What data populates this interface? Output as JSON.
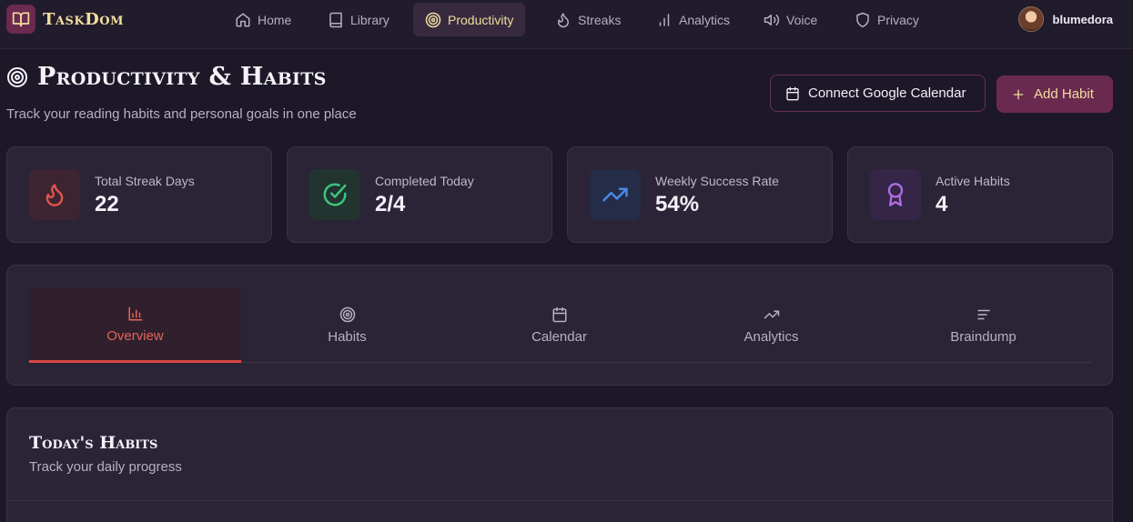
{
  "app": {
    "name": "TaskDom"
  },
  "nav": {
    "items": [
      {
        "label": "Home",
        "icon": "home-icon"
      },
      {
        "label": "Library",
        "icon": "book-icon"
      },
      {
        "label": "Productivity",
        "icon": "target-icon",
        "active": true
      },
      {
        "label": "Streaks",
        "icon": "flame-icon"
      },
      {
        "label": "Analytics",
        "icon": "bar-chart-icon"
      },
      {
        "label": "Voice",
        "icon": "speaker-icon"
      },
      {
        "label": "Privacy",
        "icon": "shield-icon"
      }
    ],
    "user": {
      "name": "blumedora"
    }
  },
  "header": {
    "title": "Productivity & Habits",
    "subtitle": "Track your reading habits and personal goals in one place",
    "connect_calendar_label": "Connect Google Calendar",
    "add_habit_label": "Add Habit"
  },
  "stats": [
    {
      "label": "Total Streak Days",
      "value": "22",
      "icon": "flame-icon",
      "color": "#e0564f"
    },
    {
      "label": "Completed Today",
      "value": "2/4",
      "icon": "check-circle-icon",
      "color": "#3cc47a"
    },
    {
      "label": "Weekly Success Rate",
      "value": "54%",
      "icon": "trending-up-icon",
      "color": "#4b86e8"
    },
    {
      "label": "Active Habits",
      "value": "4",
      "icon": "award-icon",
      "color": "#b06ee8"
    }
  ],
  "tabs": [
    {
      "label": "Overview",
      "icon": "bar-chart-icon",
      "active": true
    },
    {
      "label": "Habits",
      "icon": "target-icon"
    },
    {
      "label": "Calendar",
      "icon": "calendar-icon"
    },
    {
      "label": "Analytics",
      "icon": "trending-up-icon"
    },
    {
      "label": "Braindump",
      "icon": "text-lines-icon"
    }
  ],
  "habits": {
    "title": "Today's Habits",
    "subtitle": "Track your daily progress"
  },
  "colors": {
    "background": "#1c1827",
    "card": "#2a2436",
    "accent": "#6a2a50",
    "gold": "#f1dd9d",
    "tab_active": "#e46457"
  }
}
